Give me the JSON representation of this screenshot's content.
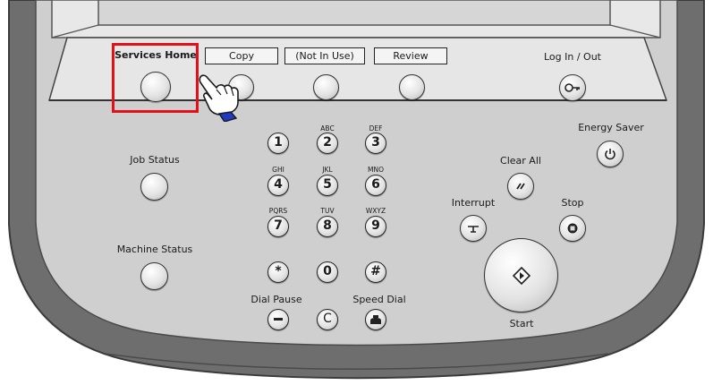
{
  "top_tabs": {
    "services_home": "Services Home",
    "copy": "Copy",
    "not_in_use": "(Not In Use)",
    "review": "Review",
    "log_in_out": "Log In / Out"
  },
  "side_buttons": {
    "job_status": "Job Status",
    "machine_status": "Machine Status"
  },
  "keypad": [
    {
      "key": "1",
      "letters": ""
    },
    {
      "key": "2",
      "letters": "ABC"
    },
    {
      "key": "3",
      "letters": "DEF"
    },
    {
      "key": "4",
      "letters": "GHI"
    },
    {
      "key": "5",
      "letters": "JKL"
    },
    {
      "key": "6",
      "letters": "MNO"
    },
    {
      "key": "7",
      "letters": "PQRS"
    },
    {
      "key": "8",
      "letters": "TUV"
    },
    {
      "key": "9",
      "letters": "WXYZ"
    },
    {
      "key": "*",
      "letters": ""
    },
    {
      "key": "0",
      "letters": ""
    },
    {
      "key": "#",
      "letters": ""
    }
  ],
  "bottom_keys": {
    "dial_pause": "Dial Pause",
    "speed_dial": "Speed Dial",
    "clear_key": "C"
  },
  "right_controls": {
    "energy_saver": "Energy Saver",
    "clear_all": "Clear All",
    "interrupt": "Interrupt",
    "stop": "Stop",
    "start": "Start"
  },
  "colors": {
    "highlight": "#e3101a",
    "panel": "#cdcdcd",
    "frame": "#6d6d6d",
    "pointer": "#1f3bbf"
  },
  "icons": [
    "hand-pointer-icon",
    "key-icon",
    "power-icon",
    "clear-all-icon",
    "interrupt-icon",
    "stop-icon",
    "start-diamond-icon",
    "minus-icon",
    "speed-dial-icon"
  ]
}
